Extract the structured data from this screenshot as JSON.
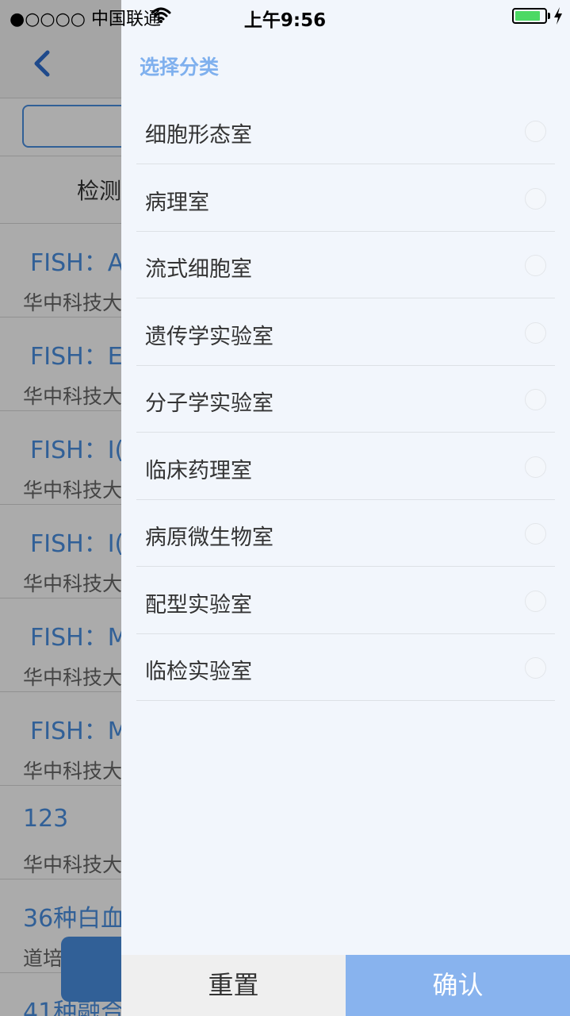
{
  "status_bar": {
    "signal_dots": "●○○○○",
    "carrier": "中国联通",
    "time": "上午9:56",
    "battery_level": 0.85
  },
  "background_page": {
    "filter_label": "检测",
    "tests": [
      {
        "title": "FISH：A",
        "subtitle": "华中科技大"
      },
      {
        "title": "FISH：E",
        "subtitle": "华中科技大"
      },
      {
        "title": "FISH：I(",
        "subtitle": "华中科技大"
      },
      {
        "title": "FISH：I(",
        "subtitle": "华中科技大"
      },
      {
        "title": "FISH：M",
        "subtitle": "华中科技大"
      },
      {
        "title": "FISH：M",
        "subtitle": "华中科技大"
      },
      {
        "title": "123",
        "subtitle": "华中科技大"
      },
      {
        "title": "36种白血",
        "subtitle": "道培"
      },
      {
        "title": "41种融合",
        "subtitle": ""
      }
    ]
  },
  "drawer": {
    "title": "选择分类",
    "categories": [
      {
        "label": "细胞形态室",
        "selected": false
      },
      {
        "label": "病理室",
        "selected": false
      },
      {
        "label": "流式细胞室",
        "selected": false
      },
      {
        "label": "遗传学实验室",
        "selected": false
      },
      {
        "label": "分子学实验室",
        "selected": false
      },
      {
        "label": "临床药理室",
        "selected": false
      },
      {
        "label": "病原微生物室",
        "selected": false
      },
      {
        "label": "配型实验室",
        "selected": false
      },
      {
        "label": "临检实验室",
        "selected": false
      }
    ],
    "reset_label": "重置",
    "confirm_label": "确认"
  },
  "colors": {
    "accent": "#4a90e2",
    "drawer_title": "#7fb0ee",
    "confirm_bg": "#88b3ee",
    "drawer_bg": "#f2f6fc"
  }
}
